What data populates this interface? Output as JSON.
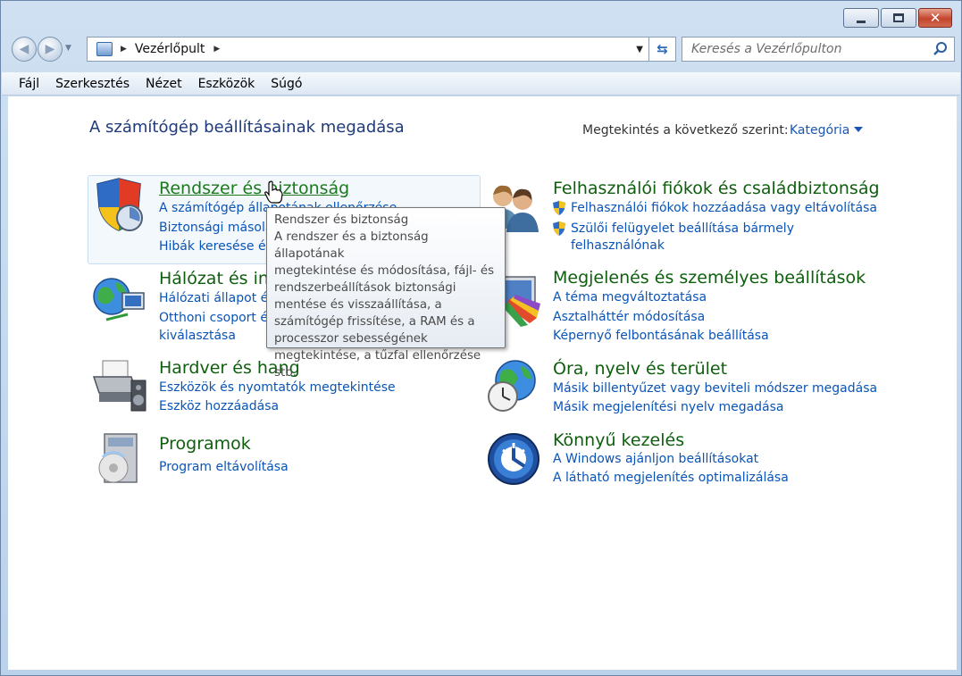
{
  "window": {
    "caption": {
      "minimize": "",
      "maximize": "",
      "close": "✕"
    }
  },
  "address": {
    "crumb": "Vezérlőpult",
    "search_placeholder": "Keresés a Vezérlőpulton"
  },
  "menubar": [
    "Fájl",
    "Szerkesztés",
    "Nézet",
    "Eszközök",
    "Súgó"
  ],
  "header": {
    "title": "A számítógép beállításainak megadása",
    "viewby_label": "Megtekintés a következő szerint:",
    "viewby_value": "Kategória"
  },
  "categories": {
    "system": {
      "title": "Rendszer és biztonság",
      "icon": "shield-icon",
      "links": [
        "A számítógép állapotának ellenőrzése",
        "Biztonsági másolat",
        "Hibák keresése és"
      ]
    },
    "network": {
      "title": "Hálózat és internet",
      "icon": "network-globe-icon",
      "links": [
        "Hálózati állapot és",
        "Otthoni csoport és",
        "kiválasztása"
      ]
    },
    "hardware": {
      "title": "Hardver és hang",
      "icon": "printer-icon",
      "links": [
        "Eszközök és nyomtatók megtekintése",
        "Eszköz hozzáadása"
      ]
    },
    "programs": {
      "title": "Programok",
      "icon": "programs-icon",
      "links": [
        "Program eltávolítása"
      ]
    },
    "users": {
      "title": "Felhasználói fiókok és családbiztonság",
      "icon": "users-icon",
      "links": [
        "Felhasználói fiókok hozzáadása vagy eltávolítása",
        "Szülői felügyelet beállítása bármely",
        "felhasználónak"
      ]
    },
    "appearance": {
      "title": "Megjelenés és személyes beállítások",
      "icon": "appearance-icon",
      "links": [
        "A téma megváltoztatása",
        "Asztalháttér módosítása",
        "Képernyő felbontásának beállítása"
      ]
    },
    "clock": {
      "title": "Óra, nyelv és terület",
      "icon": "clock-globe-icon",
      "links": [
        "Másik billentyűzet vagy beviteli módszer megadása",
        "Másik megjelenítési nyelv megadása"
      ]
    },
    "ease": {
      "title": "Könnyű kezelés",
      "icon": "ease-of-access-icon",
      "links": [
        "A Windows ajánljon beállításokat",
        "A látható megjelenítés optimalizálása"
      ]
    }
  },
  "tooltip": {
    "title": "Rendszer és biztonság",
    "body": "A rendszer és a biztonság állapotának\nmegtekintése és módosítása, fájl- és\nrendszerbeállítások biztonsági\nmentése és visszaállítása, a\nszámítógép frissítése, a RAM és a\nprocesszor sebességének\nmegtekintése, a tűzfal ellenőrzése stb."
  },
  "colors": {
    "link": "#0a54b8",
    "category_title": "#0e5e0e",
    "page_title": "#1e3a7a"
  }
}
